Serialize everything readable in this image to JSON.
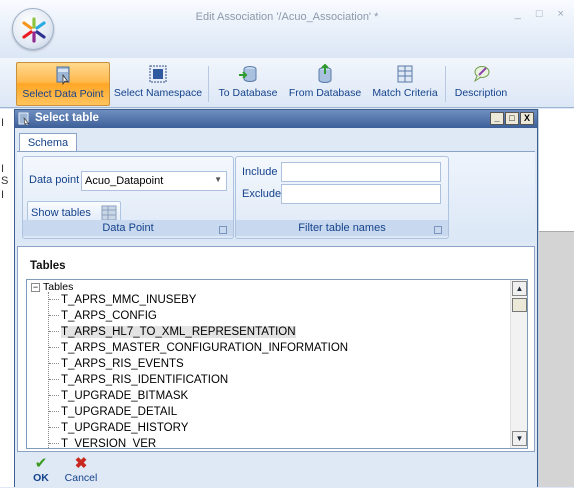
{
  "window": {
    "title": "Edit Association '/Acuo_Association' *",
    "controls": "_ □ ×"
  },
  "ribbon": {
    "buttons": [
      {
        "label": "Select Data Point",
        "icon": "table-select-icon",
        "active": true
      },
      {
        "label": "Select Namespace",
        "icon": "namespace-icon"
      },
      {
        "label": "To Database",
        "icon": "to-database-icon"
      },
      {
        "label": "From Database",
        "icon": "from-database-icon"
      },
      {
        "label": "Match Criteria",
        "icon": "match-criteria-icon"
      },
      {
        "label": "Description",
        "icon": "description-icon"
      }
    ]
  },
  "dialog": {
    "title": "Select table",
    "controls": [
      "_",
      "□",
      "X"
    ],
    "tab": "Schema",
    "data_point": {
      "label": "Data point",
      "value": "Acuo_Datapoint",
      "show_tables": "Show tables",
      "group_label": "Data Point"
    },
    "filter": {
      "include_label": "Include",
      "exclude_label": "Exclude",
      "include_value": "",
      "exclude_value": "",
      "group_label": "Filter table names"
    },
    "tables": {
      "heading": "Tables",
      "root": "Tables",
      "items": [
        "T_APRS_MMC_INUSEBY",
        "T_ARPS_CONFIG",
        "T_ARPS_HL7_TO_XML_REPRESENTATION",
        "T_ARPS_MASTER_CONFIGURATION_INFORMATION",
        "T_ARPS_RIS_EVENTS",
        "T_ARPS_RIS_IDENTIFICATION",
        "T_UPGRADE_BITMASK",
        "T_UPGRADE_DETAIL",
        "T_UPGRADE_HISTORY",
        "T_VERSION_VER"
      ],
      "selected_index": 2
    },
    "footer": {
      "ok": "OK",
      "cancel": "Cancel"
    }
  },
  "colors": {
    "accent": "#ffb94d",
    "title_bar": "#3c5f98",
    "ribbon_text": "#15428b"
  }
}
